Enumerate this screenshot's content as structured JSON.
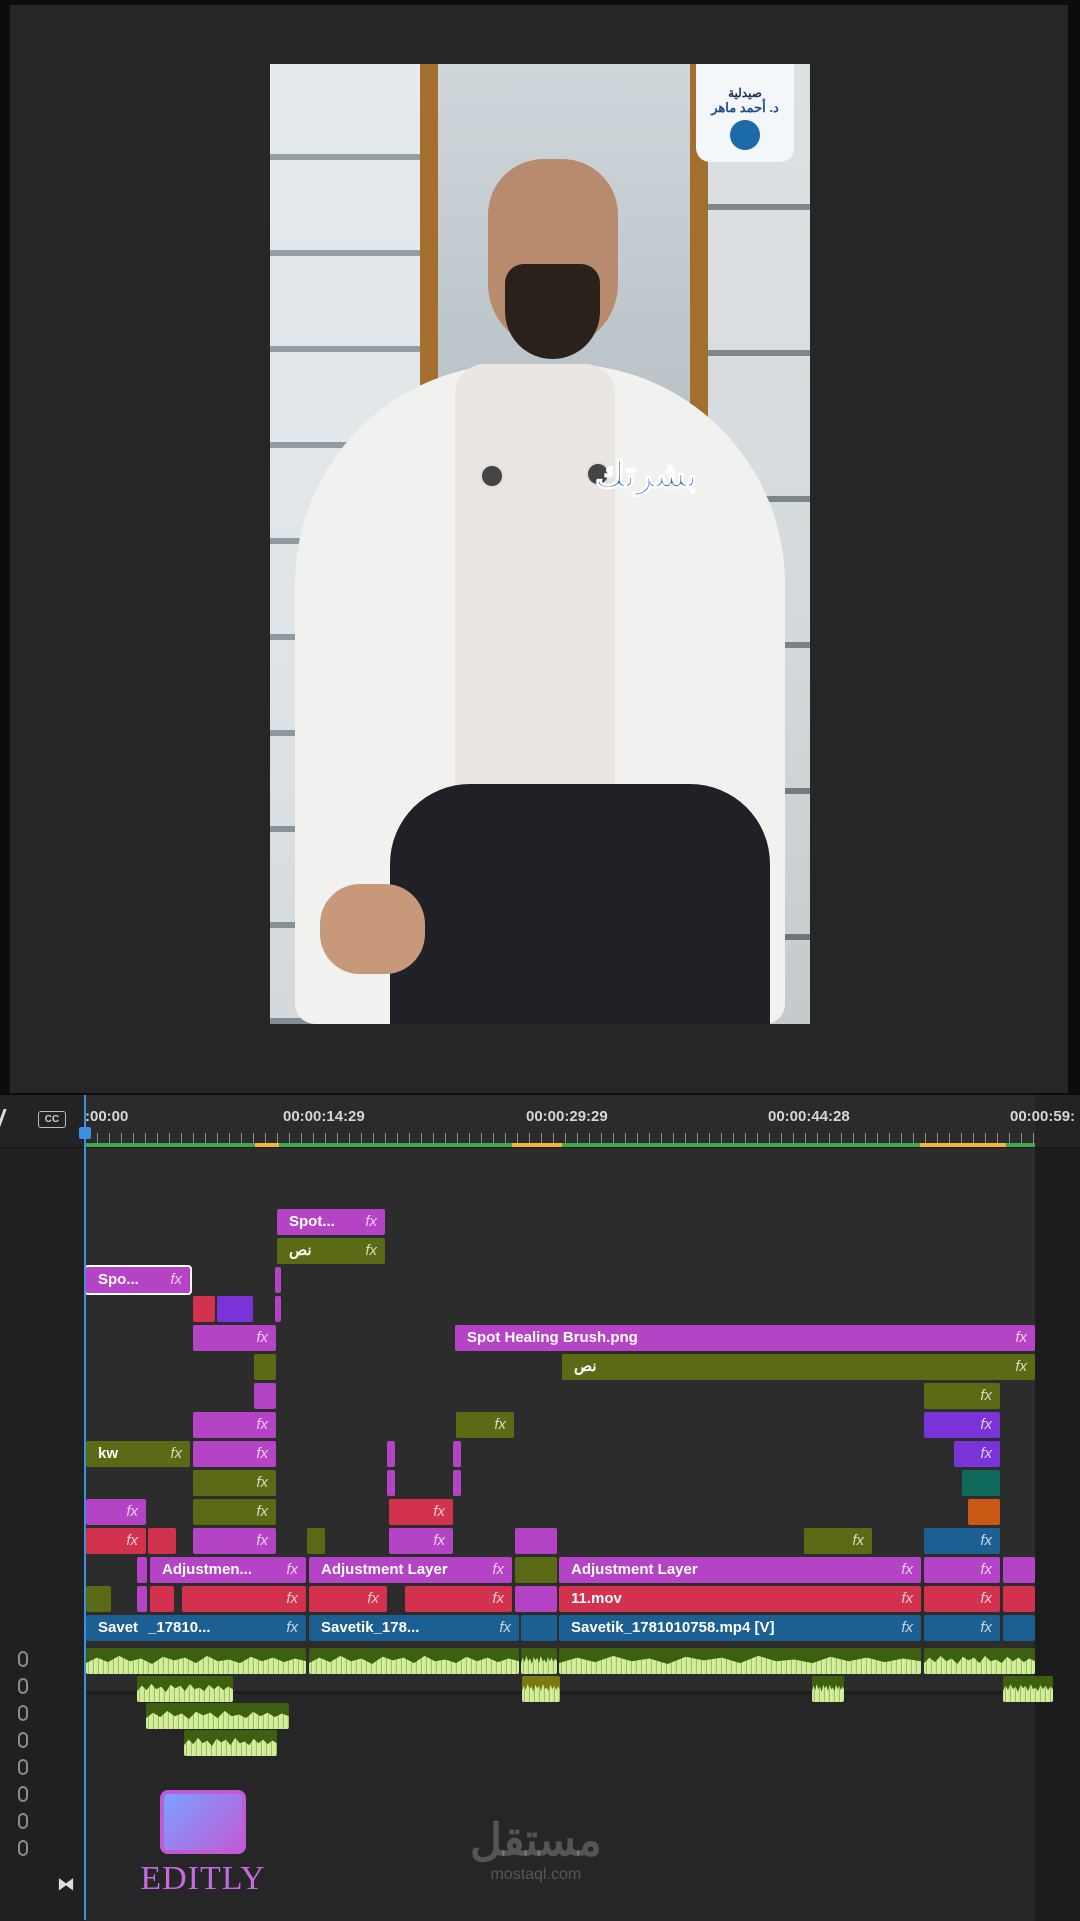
{
  "monitor": {
    "logo_line1": "صيدلية",
    "logo_line2": "د. أحمد ماهر",
    "caption": "بشرتك"
  },
  "ruler": {
    "timecodes": [
      ":00:00",
      "00:00:14:29",
      "00:00:29:29",
      "00:00:44:28",
      "00:00:59:"
    ],
    "cc_label": "CC"
  },
  "clips": {
    "spot_top": "Spot...",
    "nas1": "نص",
    "spo_sel": "Spo...",
    "spot_healing": "Spot Healing Brush.png",
    "nas2": "نص",
    "kw": "kw",
    "adj1": "Adjustmen...",
    "adj2": "Adjustment Layer",
    "adj3": "Adjustment Layer",
    "mov": "11.mov",
    "sv1": "Savet",
    "sv1b": "_17810...",
    "sv2": "Savetik_178...",
    "sv3": "Savetik_1781010758.mp4 [V]",
    "fx": "fx"
  },
  "branding": {
    "editly": "EDITLY",
    "watermark_ar": "مستقل",
    "watermark_en": "mostaql.com"
  },
  "colors": {
    "magenta": "#b543c6",
    "olive": "#5b6a14",
    "red": "#d2324e",
    "blue": "#1c5f93",
    "playhead": "#3d8fe0"
  }
}
